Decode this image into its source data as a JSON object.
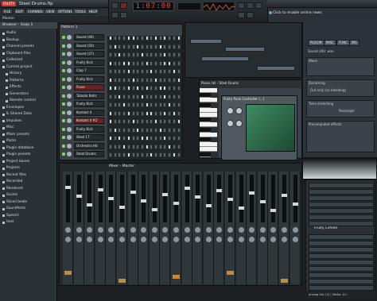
{
  "title_bar": {
    "app_logo": "FRUITY",
    "window_title": "Steel Drums.flp"
  },
  "menu": [
    "FILE",
    "EDIT",
    "CHANNELS",
    "VIEW",
    "OPTIONS",
    "TOOLS",
    "HELP"
  ],
  "hint_bar": {
    "text": "Master"
  },
  "transport": {
    "time": "1:07:00"
  },
  "news": {
    "text": "Click to enable online news"
  },
  "browser": {
    "header": "Browser - Snap 1",
    "items": [
      {
        "label": "Audio",
        "sub": false
      },
      {
        "label": "Backup",
        "sub": false
      },
      {
        "label": "Channel presets",
        "sub": false
      },
      {
        "label": "Clipboard files",
        "sub": false
      },
      {
        "label": "Collected",
        "sub": false
      },
      {
        "label": "Current project",
        "sub": false
      },
      {
        "label": "History",
        "sub": true
      },
      {
        "label": "Patterns",
        "sub": true
      },
      {
        "label": "Effects",
        "sub": true
      },
      {
        "label": "Generators",
        "sub": true
      },
      {
        "label": "Remote control",
        "sub": true
      },
      {
        "label": "Envelopes",
        "sub": false
      },
      {
        "label": "IL Shared Data",
        "sub": false
      },
      {
        "label": "Impulses",
        "sub": false
      },
      {
        "label": "Misc",
        "sub": false
      },
      {
        "label": "Mixer presets",
        "sub": false
      },
      {
        "label": "Packs",
        "sub": false
      },
      {
        "label": "Plugin database",
        "sub": false
      },
      {
        "label": "Plugin presets",
        "sub": false
      },
      {
        "label": "Project bones",
        "sub": false
      },
      {
        "label": "Projects",
        "sub": false
      },
      {
        "label": "Recent files",
        "sub": false
      },
      {
        "label": "Recorded",
        "sub": false
      },
      {
        "label": "Rendered",
        "sub": false
      },
      {
        "label": "Scores",
        "sub": false
      },
      {
        "label": "Sliced beats",
        "sub": false
      },
      {
        "label": "Soundfonts",
        "sub": false
      },
      {
        "label": "Speech",
        "sub": false
      },
      {
        "label": "User",
        "sub": false
      }
    ]
  },
  "channel_rack": {
    "title": "Pattern 1",
    "channels": [
      {
        "name": "Sound (46)",
        "red": false
      },
      {
        "name": "Sound (50)",
        "red": false
      },
      {
        "name": "Sound (37)",
        "red": false
      },
      {
        "name": "Fruity Kick",
        "red": false
      },
      {
        "name": "Clap 7",
        "red": false
      },
      {
        "name": "Fruity Kick",
        "red": false
      },
      {
        "name": "Flave",
        "red": true
      },
      {
        "name": "Tubular Bells",
        "red": false
      },
      {
        "name": "Fruity Kick",
        "red": false
      },
      {
        "name": "Kontakt 4",
        "red": false
      },
      {
        "name": "Kontakt 4 #2",
        "red": true
      },
      {
        "name": "Fruity Kick",
        "red": false
      },
      {
        "name": "Steel 17",
        "red": false
      },
      {
        "name": "Orchestra Hit",
        "red": false
      },
      {
        "name": "Steel Drums",
        "red": false
      }
    ]
  },
  "piano_roll": {
    "title": "Piano roll - Steel Drums"
  },
  "plugin_window": {
    "title": "Fruity Peak Controller (...)"
  },
  "mixer": {
    "title": "Mixer - Master"
  },
  "channel_settings": {
    "tabs": [
      "PLUGIN",
      "MISC",
      "FUNC",
      "INS"
    ],
    "sound_label": "Sound (46) .wav",
    "sections": [
      "Wave",
      "Declicking",
      "Time stretching",
      "Precomputed effects"
    ],
    "declick_value": "Out only (no bleeding)",
    "resample_value": "Resample"
  },
  "plugin_panel": {
    "title": "Fruity Limiter",
    "footer": "Analog Out 1/2 | Stellar 10..."
  },
  "colors": {
    "accent_red": "#d23a2e",
    "led_green": "#77d35b",
    "plugin_screen": "#3f8a62"
  }
}
